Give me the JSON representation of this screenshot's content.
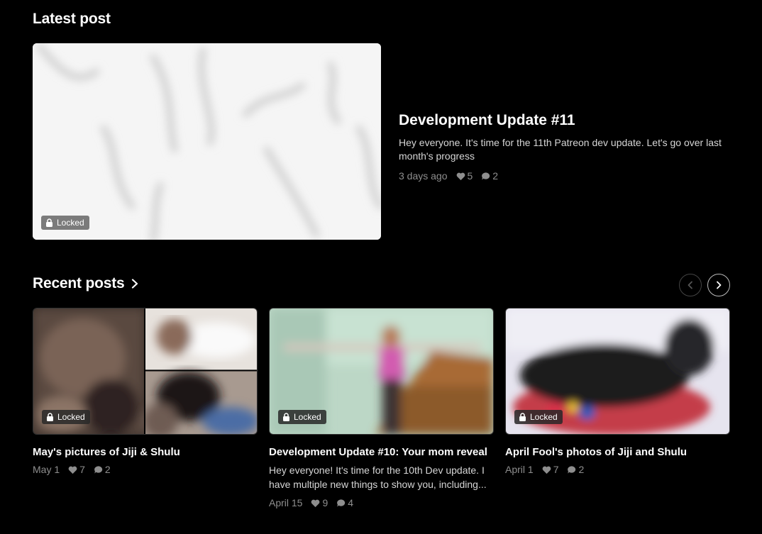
{
  "latest": {
    "section_title": "Latest post",
    "post": {
      "title": "Development Update #11",
      "excerpt": "Hey everyone. It's time for the 11th Patreon dev update. Let's go over last month's progress",
      "date": "3 days ago",
      "likes": "5",
      "comments": "2",
      "badge": "Locked"
    }
  },
  "recent": {
    "section_title": "Recent posts",
    "posts": [
      {
        "title": "May's pictures of Jiji & Shulu",
        "excerpt": "",
        "date": "May 1",
        "likes": "7",
        "comments": "2",
        "badge": "Locked"
      },
      {
        "title": "Development Update #10: Your mom reveal",
        "excerpt": "Hey everyone! It's time for the 10th Dev update. I have multiple new things to show you, including...",
        "date": "April 15",
        "likes": "9",
        "comments": "4",
        "badge": "Locked"
      },
      {
        "title": "April Fool's photos of Jiji and Shulu",
        "excerpt": "",
        "date": "April 1",
        "likes": "7",
        "comments": "2",
        "badge": "Locked"
      }
    ]
  },
  "icons": {
    "like": "heart-icon",
    "comment": "comment-bubble-icon",
    "lock": "lock-icon",
    "prev": "chevron-left-icon",
    "next": "chevron-right-icon"
  }
}
